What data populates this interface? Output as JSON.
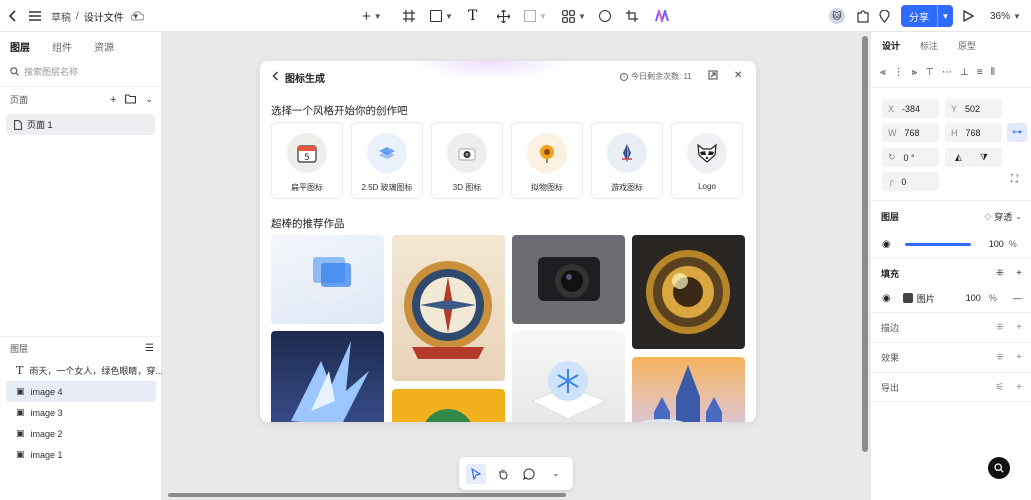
{
  "topbar": {
    "crumb_root": "草稿",
    "crumb_sep": "/",
    "crumb_file": "设计文件",
    "share_label": "分享",
    "zoom": "36%"
  },
  "left": {
    "tabs": [
      "图层",
      "组件",
      "资源"
    ],
    "search_placeholder": "搜索图层名称",
    "pages_title": "页面",
    "page_item": "页面 1",
    "layers_title": "图层",
    "layers": [
      {
        "label": "雨天，一个女人，绿色眼睛，穿..."
      },
      {
        "label": "image 4"
      },
      {
        "label": "image 3"
      },
      {
        "label": "image 2"
      },
      {
        "label": "image 1"
      }
    ]
  },
  "modal": {
    "title": "图标生成",
    "quota": "今日剩余次数: 11",
    "choose_style": "选择一个风格开始你的创作吧",
    "styles": [
      {
        "label": "扁平图标"
      },
      {
        "label": "2.5D 玻璃图标"
      },
      {
        "label": "3D 图标"
      },
      {
        "label": "拟物图标"
      },
      {
        "label": "游戏图标"
      },
      {
        "label": "Logo"
      }
    ],
    "recommend": "超棒的推荐作品"
  },
  "right": {
    "tabs": [
      "设计",
      "标注",
      "原型"
    ],
    "x_key": "X",
    "x": "-384",
    "y_key": "Y",
    "y": "502",
    "w_key": "W",
    "w": "768",
    "h_key": "H",
    "h": "768",
    "rotation": "0 °",
    "radius": "0",
    "layer_title": "图层",
    "blend": "穿透",
    "opacity": "100",
    "pct": "%",
    "fill_title": "填充",
    "fill_type": "图片",
    "fill_opacity": "100",
    "stroke_title": "描边",
    "effect_title": "效果",
    "export_title": "导出"
  },
  "colors": {
    "accent": "#2f6bff",
    "canvas": "#e9e9e9"
  }
}
